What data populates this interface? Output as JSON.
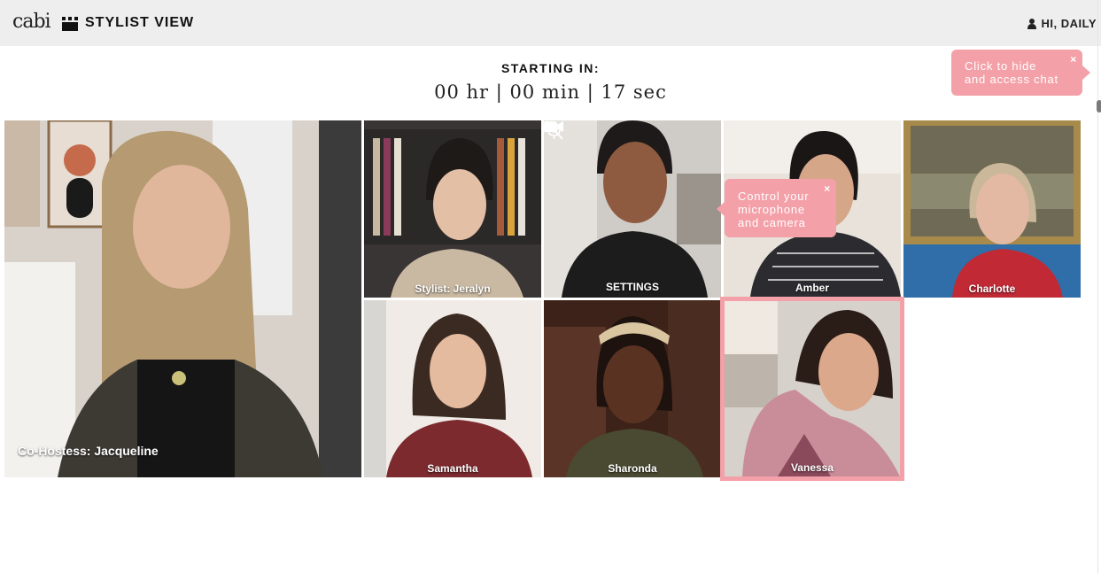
{
  "header": {
    "logo_text": "cabi",
    "view_title": "STYLIST VIEW",
    "greeting": "HI, DAILY"
  },
  "countdown": {
    "label": "STARTING IN:",
    "time_text": "00 hr | 00 min | 17 sec"
  },
  "tooltips": {
    "chat_line1": "Click to hide",
    "chat_line2": "and access chat",
    "mic_line1": "Control your",
    "mic_line2": "microphone",
    "mic_line3": "and camera",
    "close": "×"
  },
  "tiles": [
    {
      "name": "Co-Hostess: Jacqueline"
    },
    {
      "name": "Stylist: Jeralyn"
    },
    {
      "name": "SETTINGS"
    },
    {
      "name": "Amber"
    },
    {
      "name": "Charlotte"
    },
    {
      "name": "Samantha"
    },
    {
      "name": "Sharonda"
    },
    {
      "name": "Vanessa"
    }
  ],
  "colors": {
    "accent_pink": "#f4a0a8",
    "header_bg": "#eeeeee"
  },
  "icons": [
    "user-icon",
    "view-grid-icon",
    "mic-off-icon",
    "camera-icon",
    "close-icon"
  ]
}
